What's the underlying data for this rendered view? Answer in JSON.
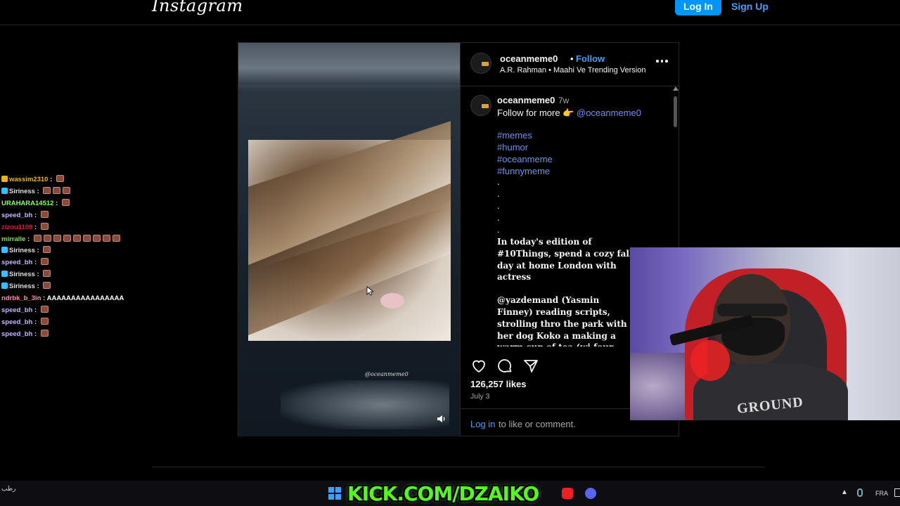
{
  "header": {
    "logo": "Instagram",
    "login_label": "Log In",
    "signup_label": "Sign Up"
  },
  "chat": [
    {
      "user": "wassim2310",
      "color": "#e7b21b",
      "badge": "#e7b21b",
      "emotes": 1,
      "text": ""
    },
    {
      "user": "Siriness",
      "color": "#e0e0e0",
      "badge": "#36c0ff",
      "emotes": 3,
      "text": ""
    },
    {
      "user": "URAHARA14512",
      "color": "#88ff66",
      "badge": "",
      "emotes": 1,
      "text": ""
    },
    {
      "user": "speed_bh",
      "color": "#c8b3ff",
      "badge": "",
      "emotes": 1,
      "text": ""
    },
    {
      "user": "zizou1109",
      "color": "#d9163a",
      "badge": "",
      "emotes": 1,
      "text": ""
    },
    {
      "user": "mirralle",
      "color": "#7ce04a",
      "badge": "",
      "emotes": 9,
      "text": ""
    },
    {
      "user": "Siriness",
      "color": "#e0e0e0",
      "badge": "#36c0ff",
      "emotes": 1,
      "text": ""
    },
    {
      "user": "speed_bh",
      "color": "#c8b3ff",
      "badge": "",
      "emotes": 1,
      "text": ""
    },
    {
      "user": "Siriness",
      "color": "#e0e0e0",
      "badge": "#36c0ff",
      "emotes": 1,
      "text": ""
    },
    {
      "user": "Siriness",
      "color": "#e0e0e0",
      "badge": "#36c0ff",
      "emotes": 1,
      "text": ""
    },
    {
      "user": "ndrbk_b_3in",
      "color": "#ff8fb0",
      "badge": "",
      "emotes": 0,
      "text": "AAAAAAAAAAAAAAAA"
    },
    {
      "user": "speed_bh",
      "color": "#c8b3ff",
      "badge": "",
      "emotes": 1,
      "text": ""
    },
    {
      "user": "speed_bh",
      "color": "#c8b3ff",
      "badge": "",
      "emotes": 1,
      "text": ""
    },
    {
      "user": "speed_bh",
      "color": "#c8b3ff",
      "badge": "",
      "emotes": 1,
      "text": ""
    }
  ],
  "post": {
    "media_watermark": "@oceanmeme0",
    "header": {
      "username": "oceanmeme0",
      "dot": "•",
      "follow_label": "Follow",
      "audio": "A.R. Rahman • Maahi Ve Trending Version"
    },
    "caption": {
      "username": "oceanmeme0",
      "time": "7w",
      "text_prefix": "Follow for more 👉 ",
      "mention": "@oceanmeme0",
      "hashtags": [
        "#memes",
        "#humor",
        "#oceanmeme",
        "#funnymeme"
      ],
      "dots": [
        ".",
        ".",
        ".",
        ".",
        "."
      ],
      "serif_paragraph_1": "In today's edition of #10Things, spend a cozy fall day at home London with actress",
      "serif_paragraph_2": "@yazdemand (Yasmin Finney) reading scripts, strolling thro the park with her dog Koko a making a warm cup of tea (wi four scoops of sugar, no less) \"My favorite thing about Lond"
    },
    "likes": "126,257 likes",
    "date": "July 3",
    "comment_login": "Log in",
    "comment_rest": " to like or comment."
  },
  "webcam": {
    "shirt_text": "GROUND"
  },
  "taskbar": {
    "left_text": "رطب",
    "overlay_text": "KICK.COM/DZAIKO",
    "lang": "FRA"
  }
}
